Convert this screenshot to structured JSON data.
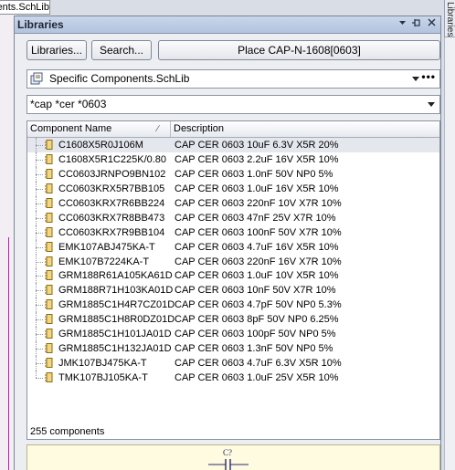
{
  "document_tab": {
    "title": "Specific Components.SchLib"
  },
  "right_panel_tab": {
    "label": "Libraries"
  },
  "panel": {
    "title": "Libraries",
    "buttons": {
      "libraries": "Libraries...",
      "search": "Search...",
      "place": "Place CAP-N-1608[0603]"
    },
    "library_selector": {
      "value": "Specific Components.SchLib",
      "more": "•••"
    },
    "filter": {
      "value": "*cap *cer *0603"
    },
    "columns": {
      "name": "Component Name",
      "description": "Description"
    },
    "components": [
      {
        "name": "C1608X5R0J106M",
        "description": "CAP CER 0603 10uF 6.3V X5R 20%"
      },
      {
        "name": "C1608X5R1C225K/0.80",
        "description": "CAP CER 0603 2.2uF 16V X5R 10%"
      },
      {
        "name": "CC0603JRNPO9BN102",
        "description": "CAP CER 0603 1.0nF 50V NP0 5%"
      },
      {
        "name": "CC0603KRX5R7BB105",
        "description": "CAP CER 0603 1.0uF 16V X5R 10%"
      },
      {
        "name": "CC0603KRX7R6BB224",
        "description": "CAP CER 0603 220nF 10V X7R 10%"
      },
      {
        "name": "CC0603KRX7R8BB473",
        "description": "CAP CER 0603 47nF 25V X7R 10%"
      },
      {
        "name": "CC0603KRX7R9BB104",
        "description": "CAP CER 0603 100nF 50V X7R 10%"
      },
      {
        "name": "EMK107ABJ475KA-T",
        "description": "CAP CER 0603 4.7uF 16V X5R 10%"
      },
      {
        "name": "EMK107B7224KA-T",
        "description": "CAP CER 0603 220nF 16V X7R 10%"
      },
      {
        "name": "GRM188R61A105KA61D",
        "description": "CAP CER 0603 1.0uF 10V X5R 10%"
      },
      {
        "name": "GRM188R71H103KA01D",
        "description": "CAP CER 0603 10nF 50V X7R 10%"
      },
      {
        "name": "GRM1885C1H4R7CZ01D",
        "description": "CAP CER 0603 4.7pF 50V NP0 5.3%"
      },
      {
        "name": "GRM1885C1H8R0DZ01D",
        "description": "CAP CER 0603 8pF 50V NP0 6.25%"
      },
      {
        "name": "GRM1885C1H101JA01D",
        "description": "CAP CER 0603 100pF 50V NP0 5%"
      },
      {
        "name": "GRM1885C1H132JA01D",
        "description": "CAP CER 0603 1.3nF 50V NP0 5%"
      },
      {
        "name": "JMK107BJ475KA-T",
        "description": "CAP CER 0603 4.7uF 6.3V X5R 10%"
      },
      {
        "name": "TMK107BJ105KA-T",
        "description": "CAP CER 0603 1.0uF 25V X5R 10%"
      }
    ],
    "component_count": "255 components",
    "preview": {
      "designator": "C?"
    }
  },
  "colors": {
    "header_bg": "#b3c4df",
    "panel_bg": "#eceef2",
    "selected_row": "#e4e7ee",
    "preview_bg": "#fffbe0",
    "schematic_wire": "#8a3a8a"
  },
  "icons": {
    "library": "library-icon",
    "component": "component-icon",
    "pin": "pin-icon",
    "close": "close-icon",
    "menu": "dropdown-menu-icon"
  }
}
